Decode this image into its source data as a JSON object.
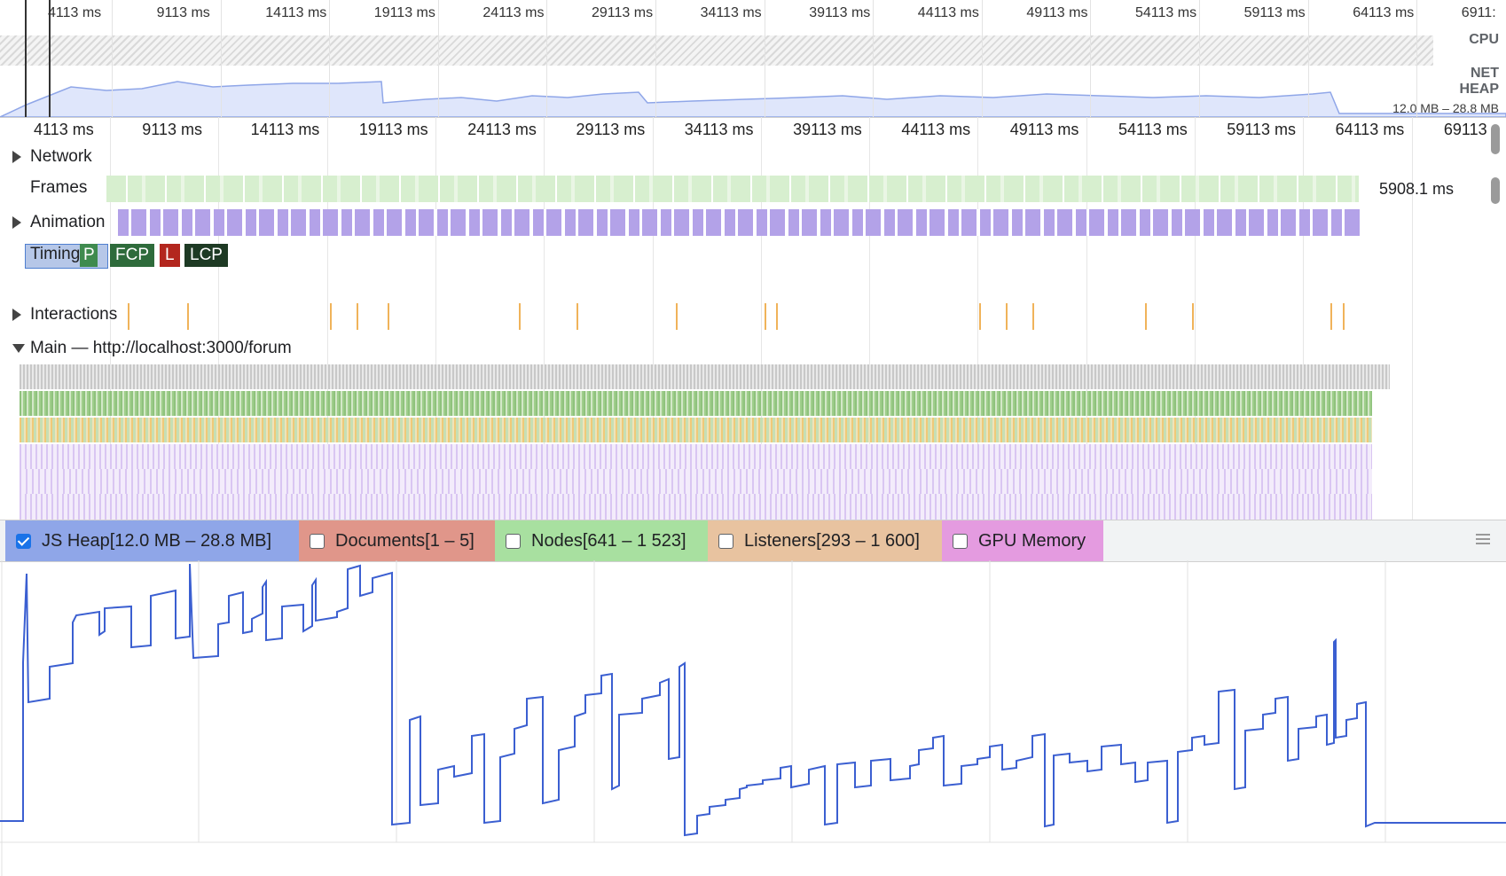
{
  "overview": {
    "ticks": [
      "4113 ms",
      "9113 ms",
      "14113 ms",
      "19113 ms",
      "24113 ms",
      "29113 ms",
      "34113 ms",
      "39113 ms",
      "44113 ms",
      "49113 ms",
      "54113 ms",
      "59113 ms",
      "64113 ms",
      "6911:"
    ],
    "tracks": {
      "cpu": "CPU",
      "net": "NET",
      "heap": "HEAP"
    },
    "heap_range": "12.0 MB – 28.8 MB"
  },
  "timeline": {
    "ticks": [
      "4113 ms",
      "9113 ms",
      "14113 ms",
      "19113 ms",
      "24113 ms",
      "29113 ms",
      "34113 ms",
      "39113 ms",
      "44113 ms",
      "49113 ms",
      "54113 ms",
      "59113 ms",
      "64113 ms",
      "69113"
    ],
    "tracks": {
      "network": "Network",
      "frames": "Frames",
      "frames_value": "5908.1 ms",
      "animation": "Animation",
      "timings": "Timings",
      "interactions": "Interactions",
      "main": "Main — http://localhost:3000/forum"
    },
    "timing_markers": [
      {
        "label": "P",
        "color": "#3f8b4f"
      },
      {
        "label": "FCP",
        "color": "#2e6b3b"
      },
      {
        "label": "L",
        "color": "#b3261e"
      },
      {
        "label": "LCP",
        "color": "#1e3a24"
      }
    ]
  },
  "counters": [
    {
      "label": "JS Heap[12.0 MB – 28.8 MB]",
      "checked": true,
      "color": "#8fa6e8"
    },
    {
      "label": "Documents[1 – 5]",
      "checked": false,
      "color": "#e0968a"
    },
    {
      "label": "Nodes[641 – 1 523]",
      "checked": false,
      "color": "#a8e0a0"
    },
    {
      "label": "Listeners[293 – 1 600]",
      "checked": false,
      "color": "#e8c3a0"
    },
    {
      "label": "GPU Memory",
      "checked": false,
      "color": "#e49be0"
    }
  ],
  "icons": {
    "menu": "hamburger-menu-icon",
    "expand": "expand-triangle-icon",
    "collapse": "collapse-triangle-icon"
  },
  "colors": {
    "heap_line": "#3b5fd1",
    "frames": "#d7efcf",
    "animation": "#b3a2e8",
    "interaction": "#f0b35a"
  }
}
